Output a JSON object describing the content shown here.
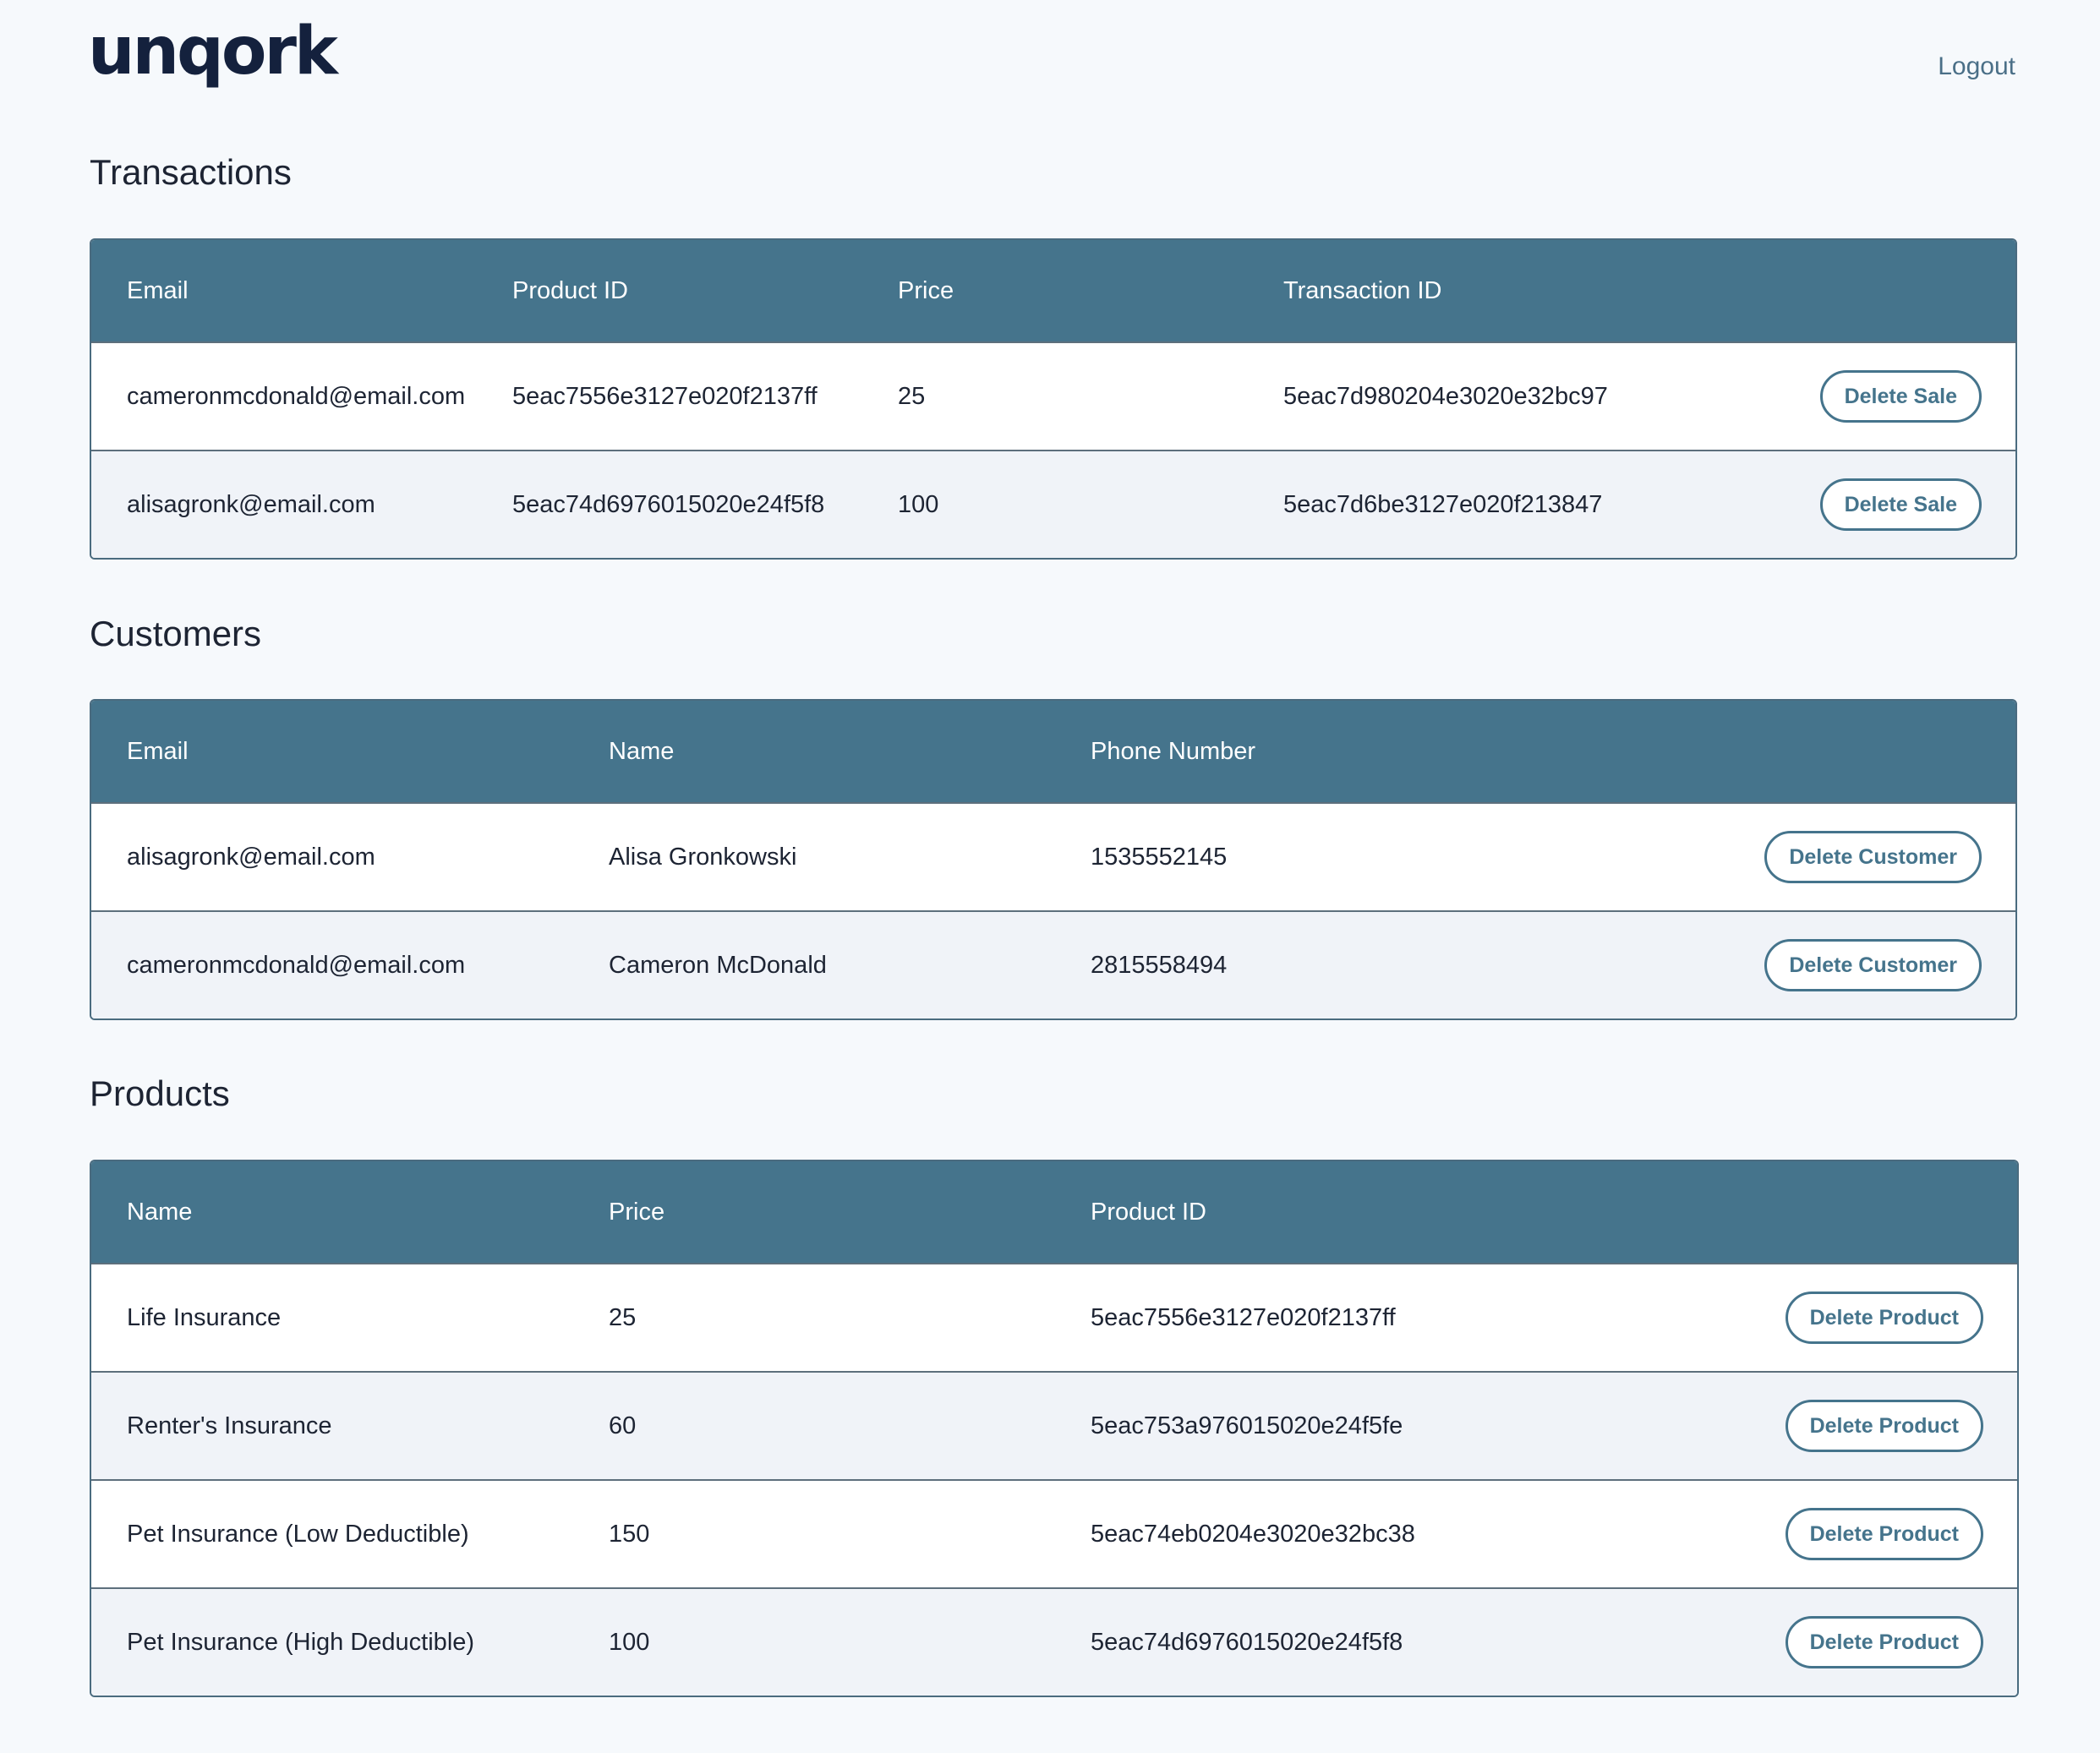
{
  "header": {
    "logo": "unqork",
    "logout_label": "Logout"
  },
  "transactions": {
    "title": "Transactions",
    "columns": [
      "Email",
      "Product ID",
      "Price",
      "Transaction ID"
    ],
    "rows": [
      {
        "email": "cameronmcdonald@email.com",
        "product_id": "5eac7556e3127e020f2137ff",
        "price": "25",
        "transaction_id": "5eac7d980204e3020e32bc97",
        "action": "Delete Sale"
      },
      {
        "email": "alisagronk@email.com",
        "product_id": "5eac74d6976015020e24f5f8",
        "price": "100",
        "transaction_id": "5eac7d6be3127e020f213847",
        "action": "Delete Sale"
      }
    ]
  },
  "customers": {
    "title": "Customers",
    "columns": [
      "Email",
      "Name",
      "Phone Number"
    ],
    "rows": [
      {
        "email": "alisagronk@email.com",
        "name": "Alisa Gronkowski",
        "phone": "1535552145",
        "action": "Delete Customer"
      },
      {
        "email": "cameronmcdonald@email.com",
        "name": "Cameron McDonald",
        "phone": "2815558494",
        "action": "Delete Customer"
      }
    ]
  },
  "products": {
    "title": "Products",
    "columns": [
      "Name",
      "Price",
      "Product ID"
    ],
    "rows": [
      {
        "name": "Life Insurance",
        "price": "25",
        "product_id": "5eac7556e3127e020f2137ff",
        "action": "Delete Product"
      },
      {
        "name": "Renter's Insurance",
        "price": "60",
        "product_id": "5eac753a976015020e24f5fe",
        "action": "Delete Product"
      },
      {
        "name": "Pet Insurance (Low Deductible)",
        "price": "150",
        "product_id": "5eac74eb0204e3020e32bc38",
        "action": "Delete Product"
      },
      {
        "name": "Pet Insurance (High Deductible)",
        "price": "100",
        "product_id": "5eac74d6976015020e24f5f8",
        "action": "Delete Product"
      }
    ]
  }
}
